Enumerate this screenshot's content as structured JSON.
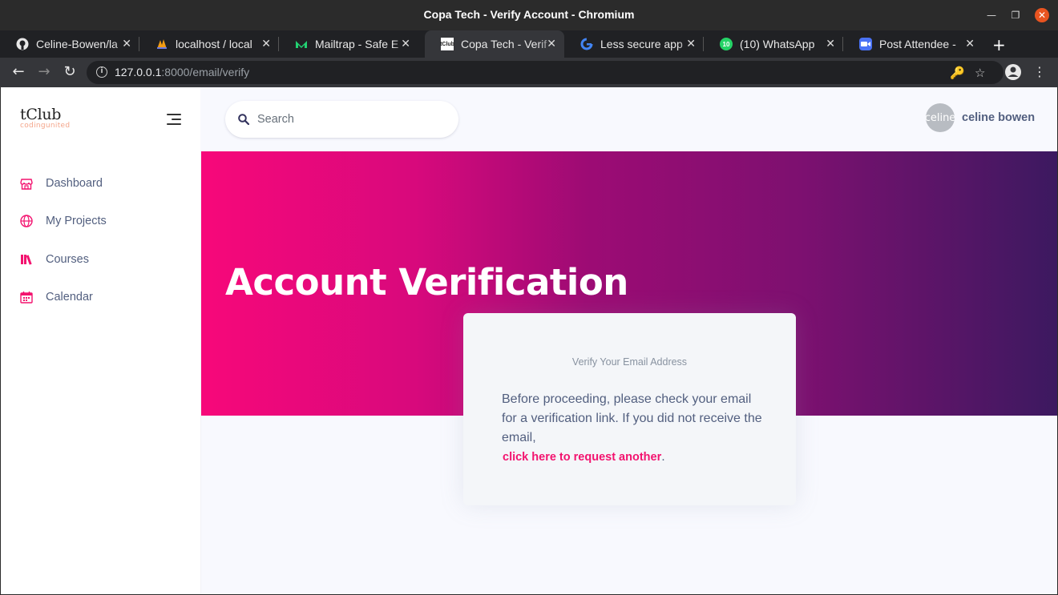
{
  "window": {
    "title": "Copa Tech - Verify Account - Chromium"
  },
  "tabs": [
    {
      "label": "Celine-Bowen/la",
      "icon": "github-icon"
    },
    {
      "label": "localhost / local",
      "icon": "phpmyadmin-icon"
    },
    {
      "label": "Mailtrap - Safe E",
      "icon": "mailtrap-icon"
    },
    {
      "label": "Copa Tech - Verif",
      "icon": "tclub-favicon",
      "active": true
    },
    {
      "label": "Less secure app",
      "icon": "google-icon"
    },
    {
      "label": "(10) WhatsApp",
      "icon": "whatsapp-icon"
    },
    {
      "label": "Post Attendee -",
      "icon": "zoom-icon"
    }
  ],
  "toolbar": {
    "url_host": "127.0.0.1",
    "url_rest": ":8000/email/verify"
  },
  "sidebar": {
    "brand": "tClub",
    "tagline": "codingunited",
    "items": [
      {
        "label": "Dashboard",
        "icon": "store-icon"
      },
      {
        "label": "My Projects",
        "icon": "globe-icon"
      },
      {
        "label": "Courses",
        "icon": "books-icon"
      },
      {
        "label": "Calendar",
        "icon": "calendar-icon"
      }
    ]
  },
  "topbar": {
    "search_placeholder": "Search",
    "avatar_alt": "celine",
    "user_name": "celine bowen"
  },
  "hero": {
    "title": "Account Verification"
  },
  "card": {
    "header": "Verify Your Email Address",
    "body": "Before proceeding, please check your email for a verification link. If you did not receive the email,",
    "link": "click here to request another",
    "suffix": "."
  },
  "colors": {
    "accent": "#f3136f",
    "sidebar_icon": "#f3136f",
    "hero_start": "#f7087a",
    "hero_end": "#3c1960"
  }
}
